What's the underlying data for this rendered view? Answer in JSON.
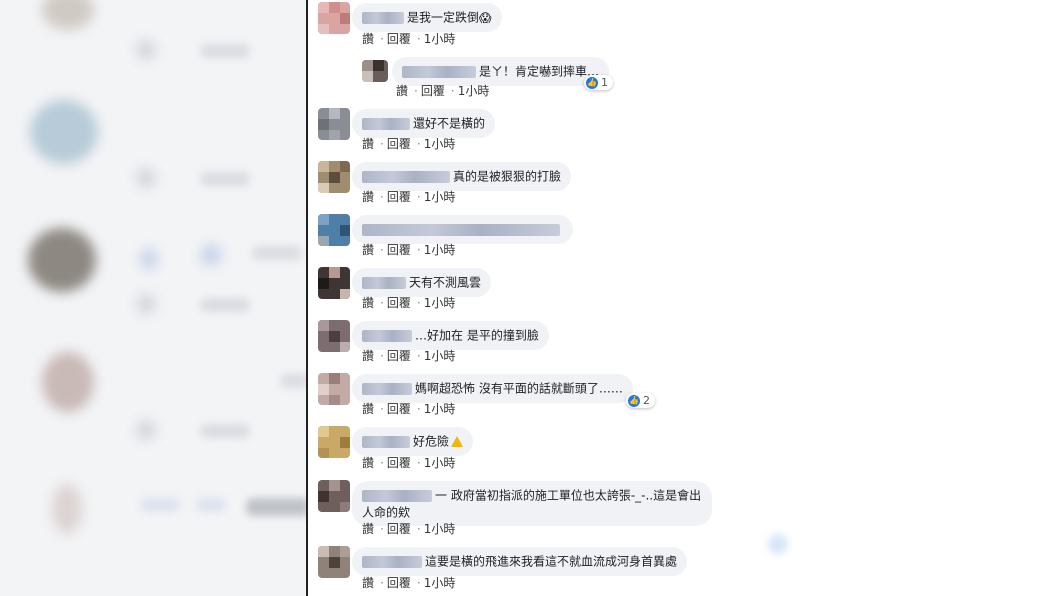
{
  "comments": [
    {
      "text": "是我一定跌倒",
      "emoji": "😱",
      "like": "讚",
      "reply": "回覆",
      "time": "1小時"
    },
    {
      "text": "是ㄚ！肯定嚇到摔車…",
      "like": "讚",
      "reply": "回覆",
      "time": "1小時",
      "reactions": "1"
    },
    {
      "text": "還好不是橫的",
      "like": "讚",
      "reply": "回覆",
      "time": "1小時"
    },
    {
      "text": "真的是被狠狠的打臉",
      "like": "讚",
      "reply": "回覆",
      "time": "1小時"
    },
    {
      "text": "",
      "like": "讚",
      "reply": "回覆",
      "time": "1小時"
    },
    {
      "text": "天有不測風雲",
      "like": "讚",
      "reply": "回覆",
      "time": "1小時"
    },
    {
      "text": "…好加在 是平的撞到臉",
      "like": "讚",
      "reply": "回覆",
      "time": "1小時"
    },
    {
      "text": "媽啊超恐怖 沒有平面的話就斷頭了……",
      "like": "讚",
      "reply": "回覆",
      "time": "1小時",
      "reactions": "2"
    },
    {
      "text": "好危險",
      "like": "讚",
      "reply": "回覆",
      "time": "1小時"
    },
    {
      "text": "一 政府當初指派的施工單位也太誇張-_-..這是會出人命的欸",
      "like": "讚",
      "reply": "回覆",
      "time": "1小時"
    },
    {
      "text": "這要是橫的飛進來我看這不就血流成河身首異處",
      "like": "讚",
      "reply": "回覆",
      "time": "1小時"
    }
  ],
  "colors": {
    "bubble": "#f0f2f5",
    "like_blue": "#1877f2",
    "divider": "#222222"
  }
}
